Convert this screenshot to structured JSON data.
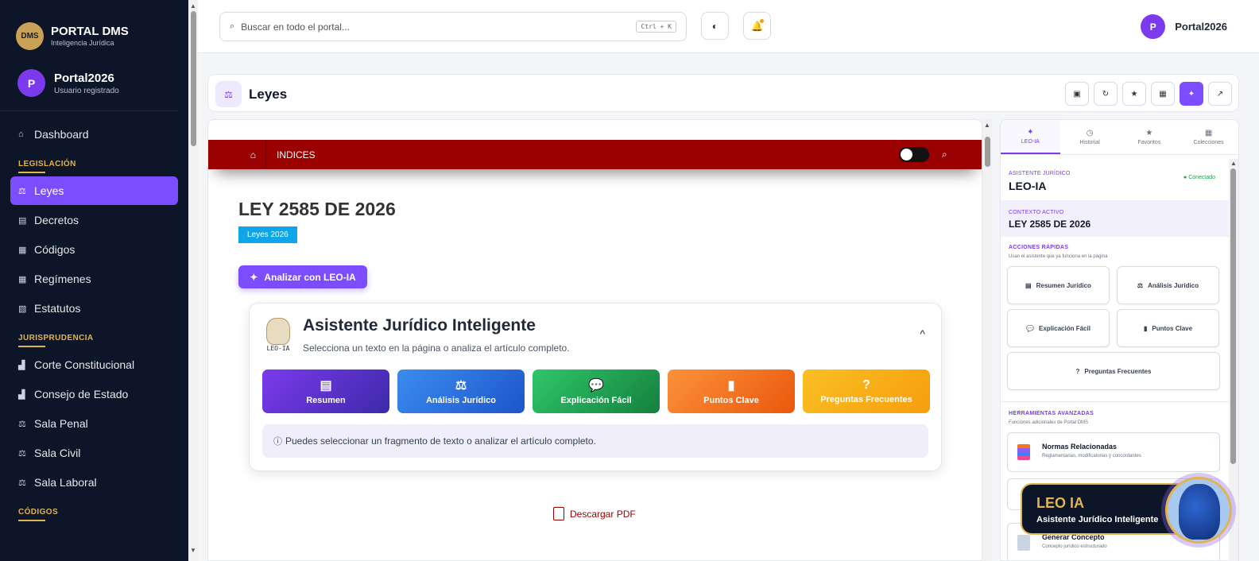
{
  "sidebar": {
    "logo_badge": "DMS",
    "logo_title": "PORTAL DMS",
    "logo_sub": "Inteligencia Jurídica",
    "user_initial": "P",
    "user_name": "Portal2026",
    "user_role": "Usuario registrado",
    "dashboard": "Dashboard",
    "sections": [
      {
        "title": "LEGISLACIÓN",
        "items": [
          "Leyes",
          "Decretos",
          "Códigos",
          "Regímenes",
          "Estatutos"
        ]
      },
      {
        "title": "JURISPRUDENCIA",
        "items": [
          "Corte Constitucional",
          "Consejo de Estado",
          "Sala Penal",
          "Sala Civil",
          "Sala Laboral"
        ]
      },
      {
        "title": "CÓDIGOS",
        "items": []
      }
    ]
  },
  "topbar": {
    "search_placeholder": "Buscar en todo el portal...",
    "shortcut": "Ctrl + K",
    "user_initial": "P",
    "user_name": "Portal2026"
  },
  "page": {
    "title": "Leyes"
  },
  "doc": {
    "nav_label": "INDICES",
    "law_title": "LEY 2585 DE 2026",
    "tag": "Leyes 2026",
    "analyze_label": "Analizar con LEO-IA",
    "assistant": {
      "logo_text": "LEO-IA",
      "title": "Asistente Jurídico Inteligente",
      "subtitle": "Selecciona un texto en la página o analiza el artículo completo.",
      "caret": "^",
      "actions": [
        {
          "label": "Resumen",
          "icon": "▤",
          "color": "#7c3aed"
        },
        {
          "label": "Análisis Jurídico",
          "icon": "⚖",
          "color": "#2563eb"
        },
        {
          "label": "Explicación Fácil",
          "icon": "💬",
          "color": "#16a34a"
        },
        {
          "label": "Puntos Clave",
          "icon": "▮",
          "color": "#ea580c"
        },
        {
          "label": "Preguntas Frecuentes",
          "icon": "?",
          "color": "#f59e0b"
        }
      ],
      "hint": "Puedes seleccionar un fragmento de texto o analizar el artículo completo."
    },
    "pdf_label": "Descargar PDF"
  },
  "right_panel": {
    "tabs": [
      "LEO-IA",
      "Historial",
      "Favoritos",
      "Colecciones"
    ],
    "assistant_label": "ASISTENTE JURÍDICO",
    "assistant_name": "LEO-IA",
    "status": "Conectado",
    "context_label": "CONTEXTO ACTIVO",
    "context_value": "LEY 2585 DE 2026",
    "quick_title": "ACCIONES RÁPIDAS",
    "quick_note": "Usan el asistente que ya funciona en la página",
    "quick": [
      "Resumen Jurídico",
      "Análisis Jurídico",
      "Explicación Fácil",
      "Puntos Clave",
      "Preguntas Frecuentes"
    ],
    "tools_title": "HERRAMIENTAS AVANZADAS",
    "tools_note": "Funciones adicionales de Portal DMS",
    "tools": [
      {
        "title": "Normas Relacionadas",
        "sub": "Reglamentarias, modificatorias y concordantes"
      },
      {
        "title": "Generar Concepto",
        "sub": "Concepto jurídico estructurado"
      }
    ]
  },
  "floating": {
    "title": "LEO IA",
    "subtitle": "Asistente Jurídico Inteligente"
  },
  "colors": {
    "accent": "#7c4dff",
    "sidebar": "#0d1628",
    "gold": "#e0b450",
    "doc_red": "#9b0000"
  }
}
